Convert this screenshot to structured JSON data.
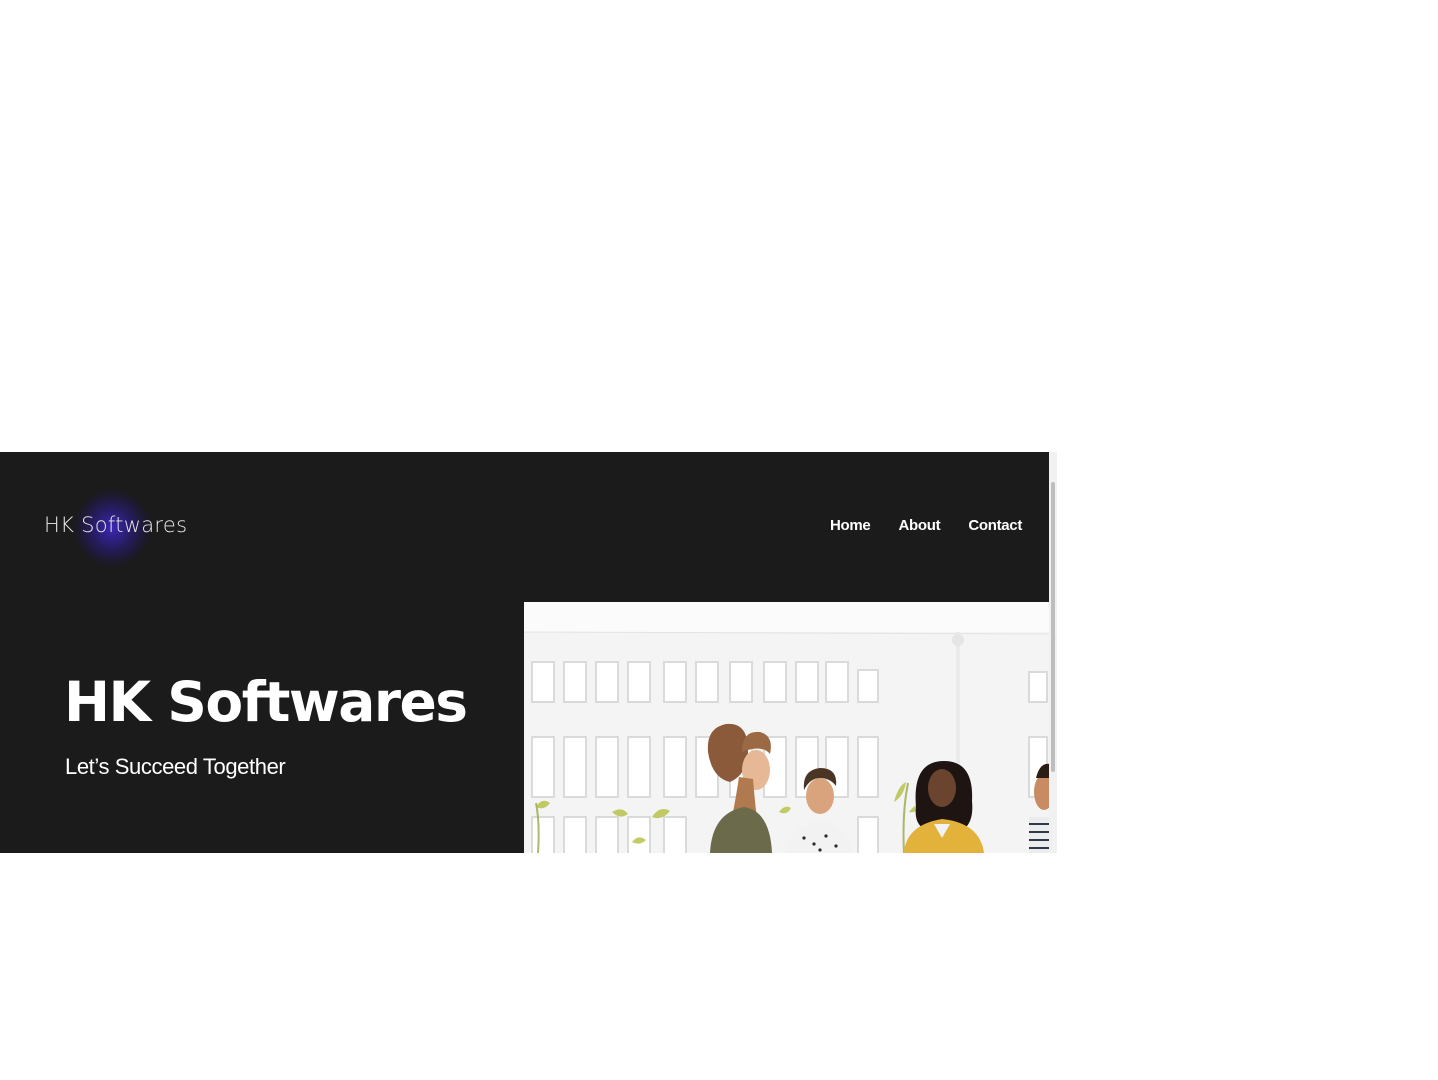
{
  "brand": {
    "logo_text": "HK Softwares",
    "glow_color": "#3a28b8"
  },
  "nav": {
    "items": [
      {
        "label": "Home"
      },
      {
        "label": "About"
      },
      {
        "label": "Contact"
      }
    ]
  },
  "hero": {
    "title": "HK Softwares",
    "subtitle": "Let’s Succeed Together",
    "image_icon": "team-meeting-photo"
  },
  "colors": {
    "page_background": "#ffffff",
    "header_background": "#1b1b1b",
    "text": "#ffffff"
  }
}
